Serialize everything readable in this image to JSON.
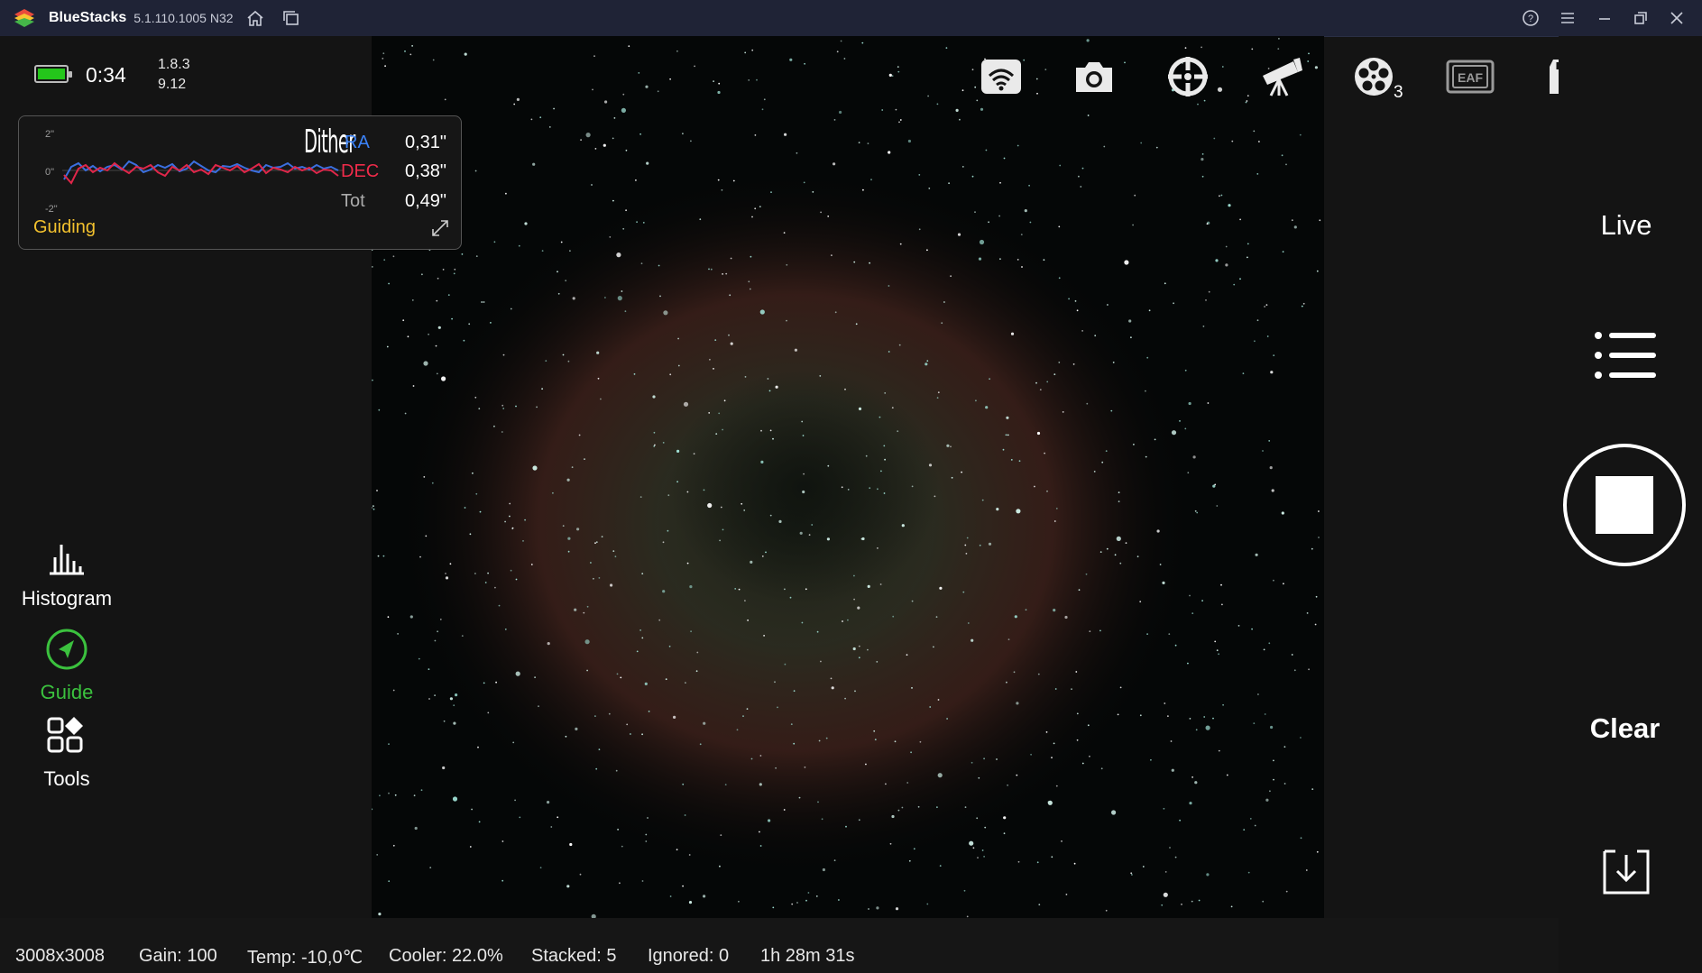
{
  "titlebar": {
    "app_name": "BlueStacks",
    "version": "5.1.110.1005  N32",
    "icons": [
      "bluestacks-logo-icon",
      "home-icon",
      "multi-instance-icon",
      "help-icon",
      "menu-icon",
      "minimize-icon",
      "restore-icon",
      "close-icon"
    ]
  },
  "status": {
    "battery_time": "0:34",
    "version_line1": "1.8.3",
    "version_line2": "9.12",
    "battery_color": "#24c61b"
  },
  "guide_panel": {
    "axis_top": "2\"",
    "axis_mid": "0\"",
    "axis_bottom": "-2\"",
    "overlay_label": "Dither",
    "ra_label": "RA",
    "dec_label": "DEC",
    "tot_label": "Tot",
    "ra_value": "0,31\"",
    "dec_value": "0,38\"",
    "tot_value": "0,49\"",
    "state": "Guiding",
    "colors": {
      "ra": "#3b82f6",
      "dec": "#ef2b4a",
      "state": "#f2c12e"
    }
  },
  "side_menu": {
    "histogram": "Histogram",
    "guide": "Guide",
    "tools": "Tools",
    "guide_color": "#3bc13e"
  },
  "toolbar": {
    "icons": [
      "wifi-icon",
      "camera-icon",
      "focus-target-icon",
      "telescope-icon",
      "filter-wheel-icon",
      "eaf-icon",
      "storage-card-icon",
      "info-icon"
    ],
    "eaf_label": "EAF",
    "filter_count": "3"
  },
  "right_panel": {
    "live": "Live",
    "clear": "Clear"
  },
  "statusbar": {
    "resolution": "3008x3008",
    "gain": "Gain: 100",
    "temp": "Temp: -10,0℃",
    "cooler": "Cooler: 22.0%",
    "stacked": "Stacked: 5",
    "ignored": "Ignored: 0",
    "elapsed": "1h 28m 31s"
  }
}
